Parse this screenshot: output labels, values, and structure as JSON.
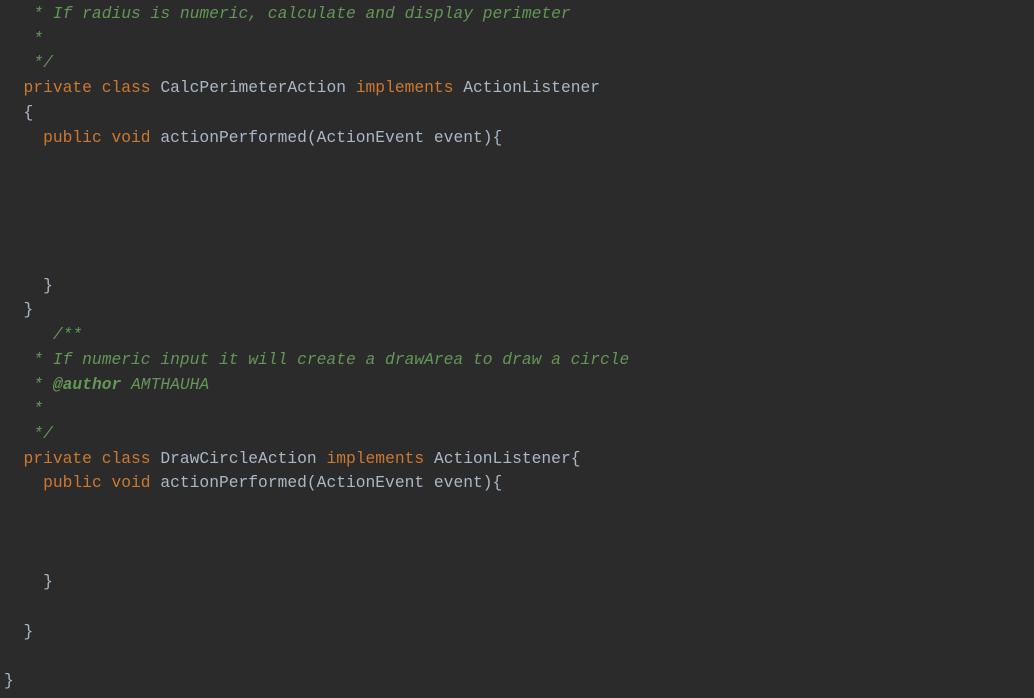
{
  "editor": {
    "theme_colors": {
      "background": "#2b2b2b",
      "keyword": "#cc7832",
      "comment": "#629755",
      "text": "#a9b7c6"
    },
    "lines": [
      [
        {
          "t": "   * If radius is numeric, calculate and display perimeter",
          "c": "cm"
        }
      ],
      [
        {
          "t": "   *",
          "c": "cm"
        }
      ],
      [
        {
          "t": "   */",
          "c": "cm"
        }
      ],
      [
        {
          "t": "  ",
          "c": "id"
        },
        {
          "t": "private class ",
          "c": "kw"
        },
        {
          "t": "CalcPerimeterAction ",
          "c": "id"
        },
        {
          "t": "implements ",
          "c": "kw"
        },
        {
          "t": "ActionListener",
          "c": "id"
        }
      ],
      [
        {
          "t": "  {",
          "c": "id"
        }
      ],
      [
        {
          "t": "    ",
          "c": "id"
        },
        {
          "t": "public void ",
          "c": "kw"
        },
        {
          "t": "actionPerformed(ActionEvent event){",
          "c": "id"
        }
      ],
      [],
      [],
      [],
      [],
      [],
      [
        {
          "t": "    }",
          "c": "id"
        }
      ],
      [
        {
          "t": "  }",
          "c": "id"
        }
      ],
      [
        {
          "t": "     /**",
          "c": "cm"
        }
      ],
      [
        {
          "t": "   * If numeric input it will create a drawArea to draw a circle",
          "c": "cm"
        }
      ],
      [
        {
          "t": "   * ",
          "c": "cm"
        },
        {
          "t": "@author",
          "c": "tag"
        },
        {
          "t": " AMTHAUHA",
          "c": "cm"
        }
      ],
      [
        {
          "t": "   *",
          "c": "cm"
        }
      ],
      [
        {
          "t": "   */",
          "c": "cm"
        }
      ],
      [
        {
          "t": "  ",
          "c": "id"
        },
        {
          "t": "private class ",
          "c": "kw"
        },
        {
          "t": "DrawCircleAction ",
          "c": "id"
        },
        {
          "t": "implements ",
          "c": "kw"
        },
        {
          "t": "ActionListener{",
          "c": "id"
        }
      ],
      [
        {
          "t": "    ",
          "c": "id"
        },
        {
          "t": "public void ",
          "c": "kw"
        },
        {
          "t": "actionPerformed(ActionEvent event){",
          "c": "id"
        }
      ],
      [],
      [],
      [],
      [
        {
          "t": "    }",
          "c": "id"
        }
      ],
      [],
      [
        {
          "t": "  }",
          "c": "id"
        }
      ],
      [],
      [
        {
          "t": "}",
          "c": "id"
        }
      ]
    ]
  }
}
